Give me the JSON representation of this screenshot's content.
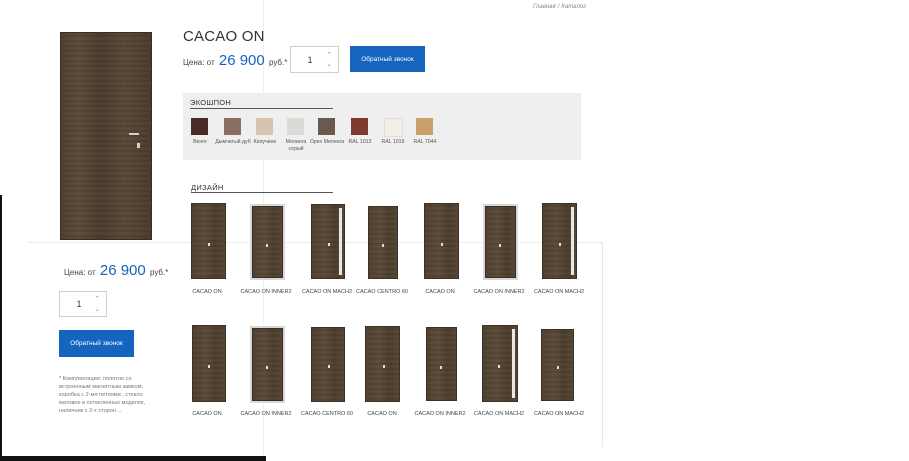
{
  "breadcrumb": {
    "home": "Главная",
    "sep": "/",
    "current": "Каталог"
  },
  "product": {
    "title": "CACAO ON",
    "price_prefix": "Цена: от",
    "price": "26 900",
    "price_suffix": "руб.*",
    "quantity": "1",
    "callback_label": "Обратный звонок",
    "note": "* Комплектация: полотно со встроенным магнитным замком, коробка с 2-мя петлями , стекло матовое в остекленных моделях, наличник с 2-х сторон ..."
  },
  "veneer": {
    "heading": "ЭКОШПОН",
    "swatches": [
      {
        "name": "Венге",
        "color": "#4a2a24"
      },
      {
        "name": "Дымчатый дуб",
        "color": "#8a7060"
      },
      {
        "name": "Капучино",
        "color": "#d6c4b0"
      },
      {
        "name": "Мелинга серый",
        "color": "#dcdad6"
      },
      {
        "name": "Орех Мелинга",
        "color": "#6a5a4e"
      },
      {
        "name": "RAL 1013",
        "color": "#7e3a2e"
      },
      {
        "name": "RAL 1019",
        "color": "#f2efe6"
      },
      {
        "name": "RAL 7044",
        "color": "#c9a069"
      }
    ]
  },
  "design": {
    "heading": "ДИЗАЙН",
    "items": [
      {
        "name": "CACAO ON"
      },
      {
        "name": "CACAO ON INNER2"
      },
      {
        "name": "CACAO ON MACH2"
      },
      {
        "name": "CACAO CENTRO 60"
      },
      {
        "name": "CACAO ON"
      },
      {
        "name": "CACAO ON INNER2"
      },
      {
        "name": "CACAO ON MACH2"
      },
      {
        "name": "CACAO ON"
      },
      {
        "name": "CACAO ON INNER2"
      },
      {
        "name": "CACAO CENTRO 60"
      },
      {
        "name": "CACAO ON"
      },
      {
        "name": "CACAO ON INNER2"
      },
      {
        "name": "CACAO ON MACH2"
      },
      {
        "name": "CACAO ON MACH2"
      }
    ]
  }
}
